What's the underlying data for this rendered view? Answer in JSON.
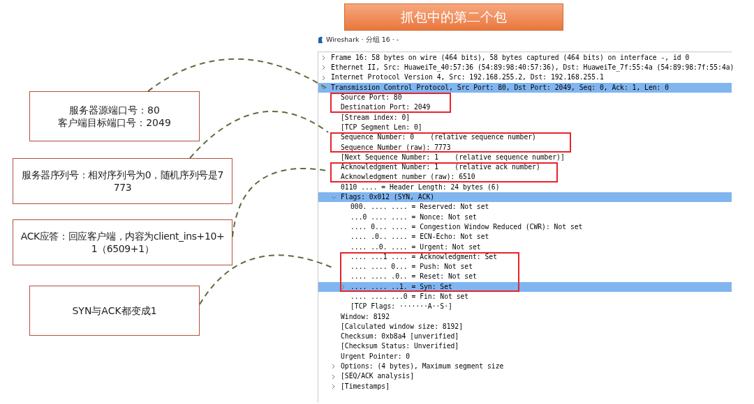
{
  "banner": {
    "title": "抓包中的第二个包"
  },
  "callouts": [
    {
      "text": "服务器源端口号：80\n客户端目标端口号：2049",
      "kind": "narrow"
    },
    {
      "text": "服务器序列号：相对序列号为0，随机序列号是7773",
      "kind": "wide"
    },
    {
      "text": "ACK应答：回应客户端，内容为client_ins+10+1（6509+1）",
      "kind": "wide"
    },
    {
      "text": "SYN与ACK都变成1",
      "kind": "narrow"
    }
  ],
  "window": {
    "title": "Wireshark · 分组 16 · -"
  },
  "tree": [
    {
      "text": "Frame 16: 58 bytes on wire (464 bits), 58 bytes captured (464 bits) on interface -, id 0",
      "expanded": false,
      "selected": false
    },
    {
      "text": "Ethernet II, Src: HuaweiTe_40:57:36 (54:89:98:40:57:36), Dst: HuaweiTe_7f:55:4a (54:89:98:7f:55:4a)",
      "expanded": false,
      "selected": false
    },
    {
      "text": "Internet Protocol Version 4, Src: 192.168.255.2, Dst: 192.168.255.1",
      "expanded": false,
      "selected": false
    },
    {
      "text": "Transmission Control Protocol, Src Port: 80, Dst Port: 2049, Seq: 0, Ack: 1, Len: 0",
      "expanded": true,
      "selected": true,
      "children": [
        {
          "text": "Source Port: 80",
          "selected": false,
          "highlighted": true
        },
        {
          "text": "Destination Port: 2049",
          "selected": false,
          "highlighted": true
        },
        {
          "text": "[Stream index: 0]",
          "selected": false,
          "highlighted": false
        },
        {
          "text": "[TCP Segment Len: 0]",
          "selected": false,
          "highlighted": false
        },
        {
          "text": "Sequence Number: 0    (relative sequence number)",
          "selected": false,
          "highlighted": true
        },
        {
          "text": "Sequence Number (raw): 7773",
          "selected": false,
          "highlighted": true
        },
        {
          "text": "[Next Sequence Number: 1    (relative sequence number)]",
          "selected": false,
          "highlighted": false
        },
        {
          "text": "Acknowledgment Number: 1    (relative ack number)",
          "selected": false,
          "highlighted": true
        },
        {
          "text": "Acknowledgment number (raw): 6510",
          "selected": false,
          "highlighted": true
        },
        {
          "text": "0110 .... = Header Length: 24 bytes (6)",
          "selected": false,
          "highlighted": false
        },
        {
          "text": "Flags: 0x012 (SYN, ACK)",
          "expanded": true,
          "selected": true,
          "highlighted": false,
          "children": [
            {
              "text": "000. .... .... = Reserved: Not set",
              "selected": false,
              "highlighted": false
            },
            {
              "text": "...0 .... .... = Nonce: Not set",
              "selected": false,
              "highlighted": false
            },
            {
              "text": ".... 0... .... = Congestion Window Reduced (CWR): Not set",
              "selected": false,
              "highlighted": false
            },
            {
              "text": ".... .0.. .... = ECN-Echo: Not set",
              "selected": false,
              "highlighted": false
            },
            {
              "text": ".... ..0. .... = Urgent: Not set",
              "selected": false,
              "highlighted": false
            },
            {
              "text": ".... ...1 .... = Acknowledgment: Set",
              "selected": false,
              "highlighted": true
            },
            {
              "text": ".... .... 0... = Push: Not set",
              "selected": false,
              "highlighted": true
            },
            {
              "text": ".... .... .0.. = Reset: Not set",
              "selected": false,
              "highlighted": true
            },
            {
              "text": ".... .... ..1. = Syn: Set",
              "expanded": false,
              "selected": true,
              "highlighted": true
            },
            {
              "text": ".... .... ...0 = Fin: Not set",
              "selected": false,
              "highlighted": false
            },
            {
              "text": "[TCP Flags: ·······A··S·]",
              "selected": false,
              "highlighted": false
            }
          ]
        },
        {
          "text": "Window: 8192",
          "selected": false,
          "highlighted": false
        },
        {
          "text": "[Calculated window size: 8192]",
          "selected": false,
          "highlighted": false
        },
        {
          "text": "Checksum: 0xb8a4 [unverified]",
          "selected": false,
          "highlighted": false
        },
        {
          "text": "[Checksum Status: Unverified]",
          "selected": false,
          "highlighted": false
        },
        {
          "text": "Urgent Pointer: 0",
          "selected": false,
          "highlighted": false
        },
        {
          "text": "Options: (4 bytes), Maximum segment size",
          "expanded": false,
          "selected": false,
          "highlighted": false
        },
        {
          "text": "[SEQ/ACK analysis]",
          "expanded": false,
          "selected": false,
          "highlighted": false
        },
        {
          "text": "[Timestamps]",
          "expanded": false,
          "selected": false,
          "highlighted": false
        }
      ]
    }
  ]
}
